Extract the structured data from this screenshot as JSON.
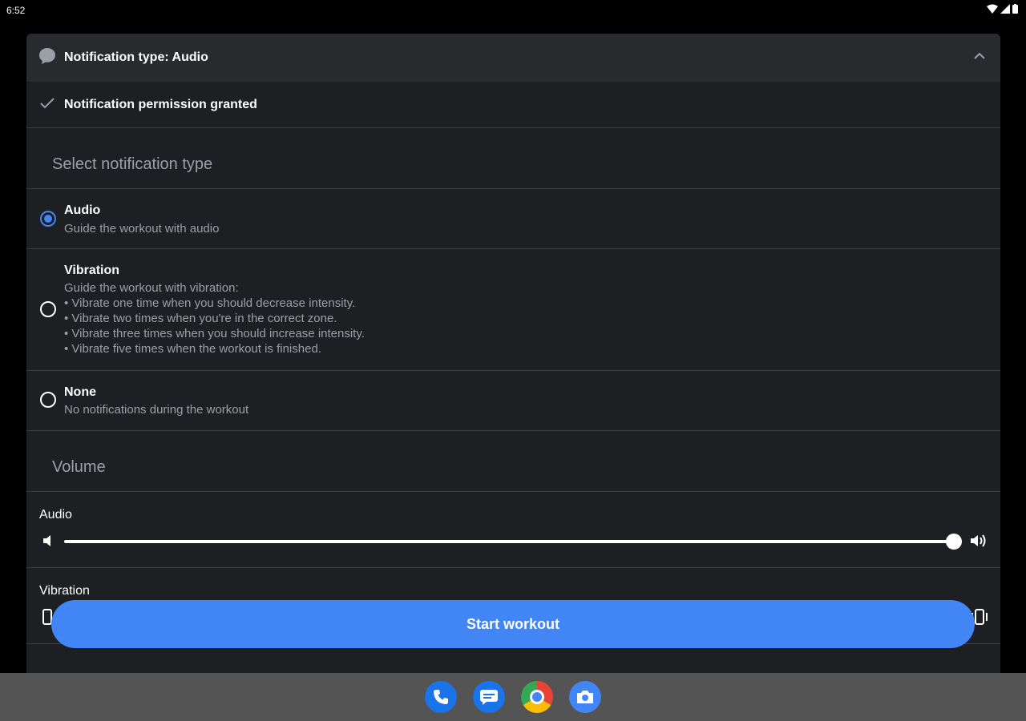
{
  "status_bar": {
    "time": "6:52"
  },
  "header": {
    "title": "Notification type: Audio"
  },
  "permission": {
    "text": "Notification permission granted"
  },
  "notification_section": {
    "title": "Select notification type"
  },
  "options": [
    {
      "label": "Audio",
      "description": "Guide the workout with audio",
      "selected": true
    },
    {
      "label": "Vibration",
      "description": "Guide the workout with vibration:\n• Vibrate one time when you should decrease intensity.\n• Vibrate two times when you're in the correct zone.\n• Vibrate three times when you should increase intensity.\n• Vibrate five times when the workout is finished.",
      "selected": false
    },
    {
      "label": "None",
      "description": "No notifications during the workout",
      "selected": false
    }
  ],
  "volume_section": {
    "title": "Volume"
  },
  "sliders": {
    "audio": {
      "label": "Audio",
      "level": 1.0
    },
    "vibration": {
      "label": "Vibration"
    }
  },
  "start_button": {
    "label": "Start workout"
  },
  "colors": {
    "accent": "#4285f4",
    "card": "#1e1f22",
    "header": "#292a2d",
    "secondary_text": "#9aa0a6"
  },
  "dock": {
    "icons": [
      "phone-icon",
      "messages-icon",
      "chrome-icon",
      "camera-icon"
    ]
  }
}
